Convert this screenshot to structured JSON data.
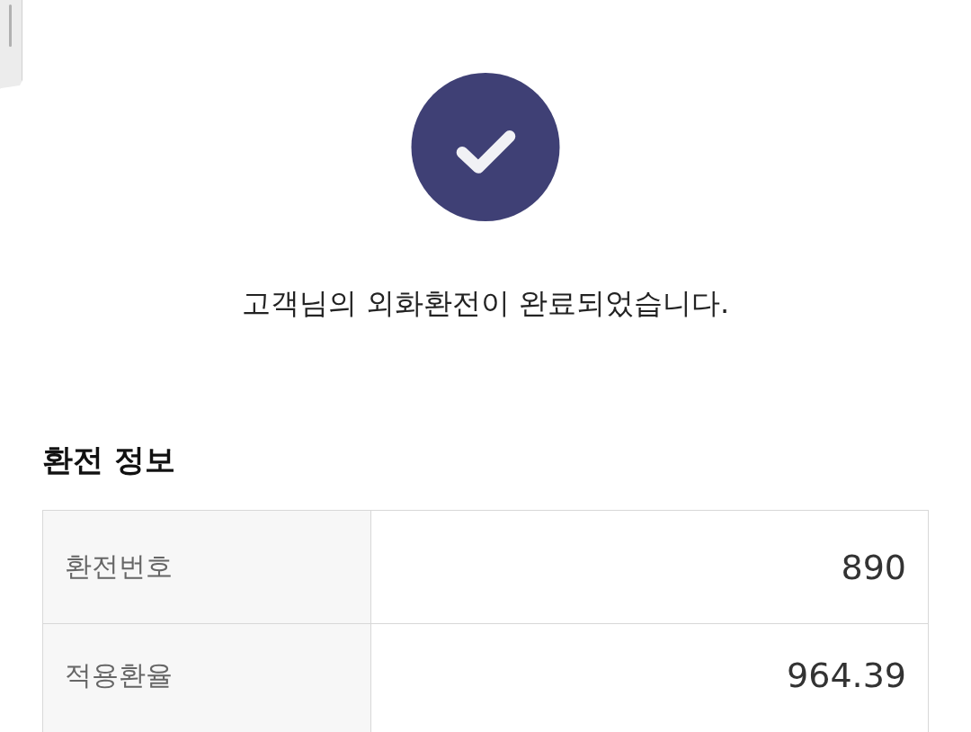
{
  "message": "고객님의 외화환전이 완료되었습니다.",
  "section": {
    "title": "환전 정보",
    "rows": [
      {
        "label": "환전번호",
        "value": "890"
      },
      {
        "label": "적용환율",
        "value": "964.39"
      }
    ]
  }
}
